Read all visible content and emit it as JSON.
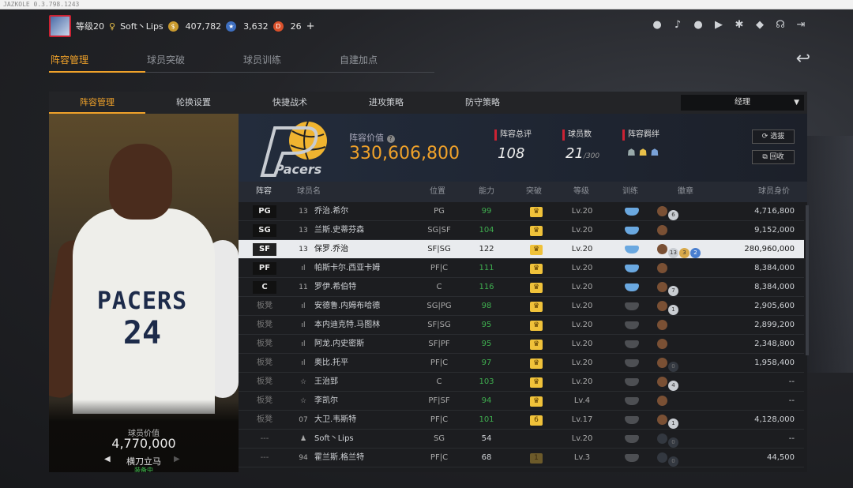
{
  "window": {
    "title": "JAZKOLE 0.3.798.1243"
  },
  "top": {
    "level": "等级20",
    "username": "Soft丶Lips",
    "gold": "407,782",
    "blue": "3,632",
    "red": "26",
    "plus": "+"
  },
  "tabs_main": [
    "阵容管理",
    "球员突破",
    "球员训练",
    "自建加点"
  ],
  "tabs_sub": [
    "阵容管理",
    "轮换设置",
    "快捷战术",
    "进攻策略",
    "防守策略"
  ],
  "select": {
    "value": "经理"
  },
  "card": {
    "team_text": "PACERS",
    "number": "24",
    "value_label": "球员价值",
    "value": "4,770,000",
    "skill": "横刀立马",
    "equip": "装备中"
  },
  "team": {
    "value_label": "阵容价值",
    "value": "330,606,800",
    "rating_label": "阵容总评",
    "rating": "108",
    "count_label": "球员数",
    "count": "21",
    "count_max": "/300",
    "bond_label": "阵容羁绊",
    "btn_select": "选拔",
    "btn_recycle": "回收",
    "logo_text": "Pacers"
  },
  "headers": {
    "lineup": "阵容",
    "name": "球员名",
    "pos": "位置",
    "ability": "能力",
    "breakthrough": "突破",
    "level": "等级",
    "train": "训练",
    "badge": "徽章",
    "value": "球员身价"
  },
  "rows": [
    {
      "slot": "PG",
      "no": "13",
      "name": "乔治.希尔",
      "pos": "PG",
      "ability": "99",
      "lv": "Lv.20",
      "value": "4,716,800"
    },
    {
      "slot": "SG",
      "no": "13",
      "name": "兰斯.史蒂芬森",
      "pos": "SG|SF",
      "ability": "104",
      "lv": "Lv.20",
      "value": "9,152,000"
    },
    {
      "slot": "SF",
      "no": "13",
      "name": "保罗.乔治",
      "pos": "SF|SG",
      "ability": "122",
      "lv": "Lv.20",
      "value": "280,960,000"
    },
    {
      "slot": "PF",
      "no": "ıl",
      "name": "帕斯卡尔.西亚卡姆",
      "pos": "PF|C",
      "ability": "111",
      "lv": "Lv.20",
      "value": "8,384,000"
    },
    {
      "slot": "C",
      "no": "11",
      "name": "罗伊.希伯特",
      "pos": "C",
      "ability": "116",
      "lv": "Lv.20",
      "value": "8,384,000"
    },
    {
      "slot": "板凳",
      "no": "ıl",
      "name": "安德鲁.内姆布哈德",
      "pos": "SG|PG",
      "ability": "98",
      "lv": "Lv.20",
      "value": "2,905,600"
    },
    {
      "slot": "板凳",
      "no": "ıl",
      "name": "本内迪克特.马图林",
      "pos": "SF|SG",
      "ability": "95",
      "lv": "Lv.20",
      "value": "2,899,200"
    },
    {
      "slot": "板凳",
      "no": "ıl",
      "name": "阿龙.内史密斯",
      "pos": "SF|PF",
      "ability": "95",
      "lv": "Lv.20",
      "value": "2,348,800"
    },
    {
      "slot": "板凳",
      "no": "ıl",
      "name": "奥比.托平",
      "pos": "PF|C",
      "ability": "97",
      "lv": "Lv.20",
      "value": "1,958,400"
    },
    {
      "slot": "板凳",
      "no": "☆",
      "name": "王治郅",
      "pos": "C",
      "ability": "103",
      "lv": "Lv.20",
      "value": "--"
    },
    {
      "slot": "板凳",
      "no": "☆",
      "name": "李凯尔",
      "pos": "PF|SF",
      "ability": "94",
      "lv": "Lv.4",
      "value": "--"
    },
    {
      "slot": "板凳",
      "no": "07",
      "name": "大卫.韦斯特",
      "pos": "PF|C",
      "ability": "101",
      "lv": "Lv.17",
      "value": "4,128,000"
    },
    {
      "slot": "---",
      "no": "♟",
      "name": "Soft丶Lips",
      "pos": "SG",
      "ability": "54",
      "lv": "Lv.20",
      "value": "--"
    },
    {
      "slot": "---",
      "no": "94",
      "name": "霍兰斯.格兰特",
      "pos": "PF|C",
      "ability": "68",
      "lv": "Lv.3",
      "value": "44,500"
    }
  ],
  "badge_nums": [
    "6",
    "13",
    "3",
    "2",
    "7",
    "1",
    "0",
    "4"
  ],
  "break_nums": [
    "6",
    "1"
  ]
}
